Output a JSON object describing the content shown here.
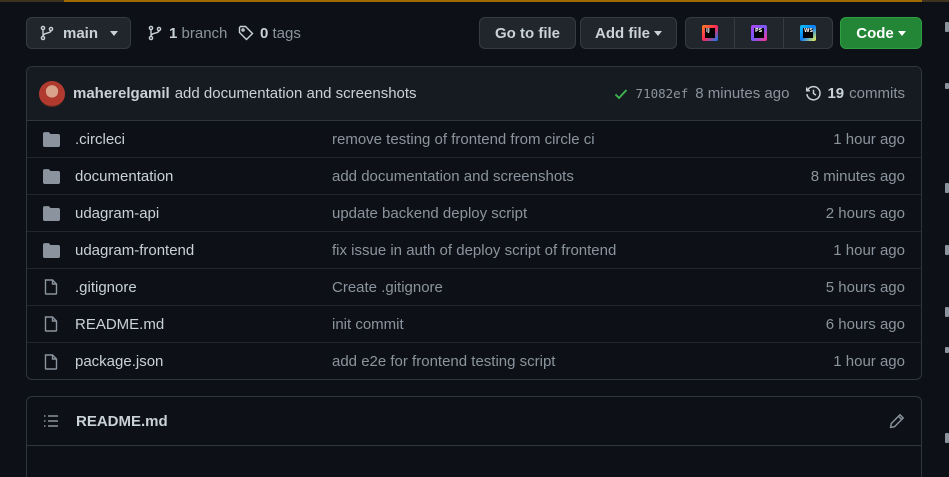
{
  "toolbar": {
    "branch_label": "main",
    "branch_count": "1",
    "branch_word": "branch",
    "tag_count": "0",
    "tag_word": "tags",
    "goto_file": "Go to file",
    "add_file": "Add file",
    "code": "Code",
    "ide_icons": [
      "intellij-icon",
      "phpstorm-icon",
      "webstorm-icon"
    ]
  },
  "latest_commit": {
    "author": "maherelgamil",
    "message": "add documentation and screenshots",
    "sha": "71082ef",
    "time": "8 minutes ago",
    "commit_count": "19",
    "commit_word": "commits"
  },
  "files": [
    {
      "type": "dir",
      "name": ".circleci",
      "message": "remove testing of frontend from circle ci",
      "age": "1 hour ago"
    },
    {
      "type": "dir",
      "name": "documentation",
      "message": "add documentation and screenshots",
      "age": "8 minutes ago"
    },
    {
      "type": "dir",
      "name": "udagram-api",
      "message": "update backend deploy script",
      "age": "2 hours ago"
    },
    {
      "type": "dir",
      "name": "udagram-frontend",
      "message": "fix issue in auth of deploy script of frontend",
      "age": "1 hour ago"
    },
    {
      "type": "file",
      "name": ".gitignore",
      "message": "Create .gitignore",
      "age": "5 hours ago"
    },
    {
      "type": "file",
      "name": "README.md",
      "message": "init commit",
      "age": "6 hours ago"
    },
    {
      "type": "file",
      "name": "package.json",
      "message": "add e2e for frontend testing script",
      "age": "1 hour ago"
    }
  ],
  "readme": {
    "title": "README.md"
  },
  "colors": {
    "background": "#0d1117",
    "primary_button": "#238636",
    "success_check": "#3fb950",
    "folder": "#8b949e"
  }
}
